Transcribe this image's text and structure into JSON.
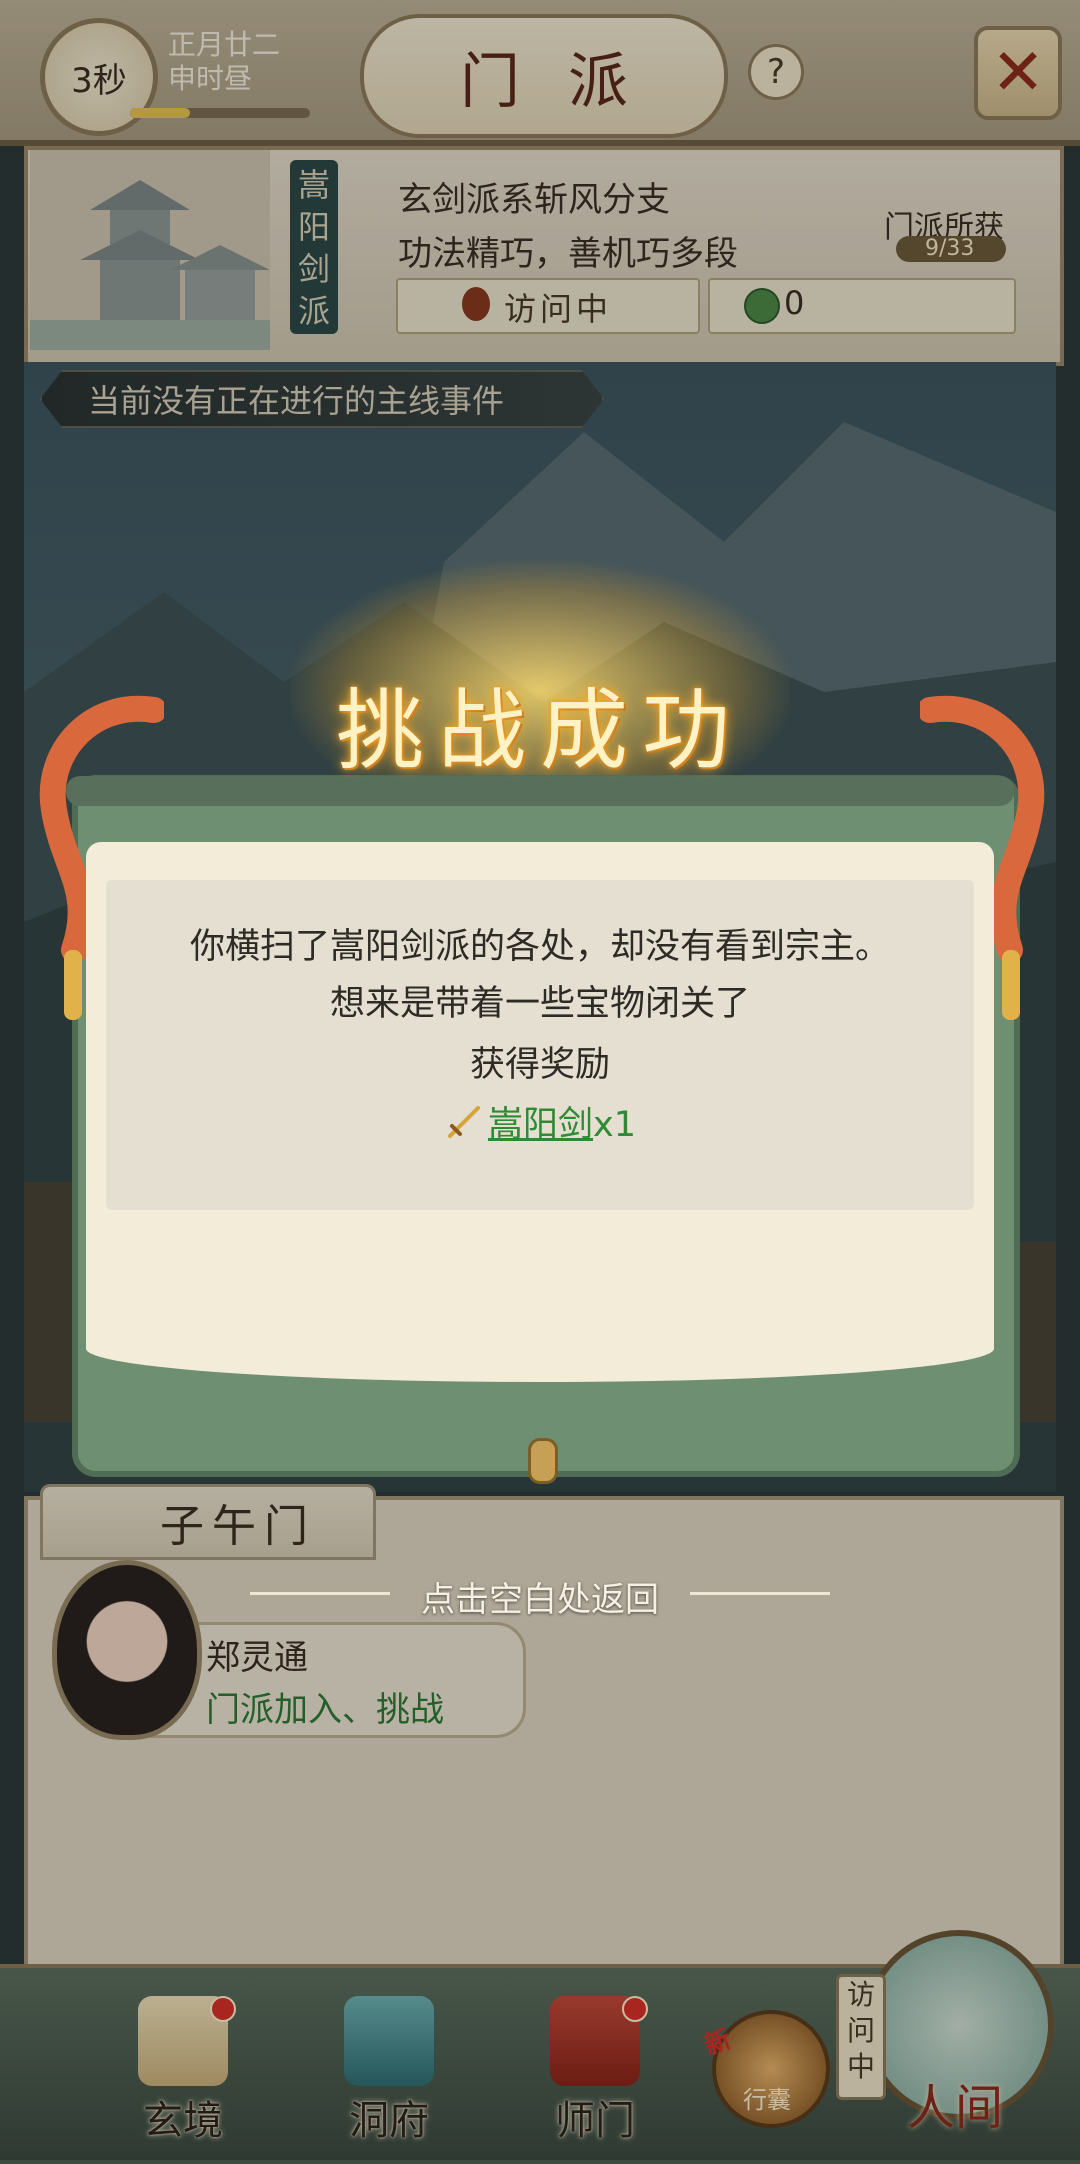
{
  "header": {
    "timer": "3秒",
    "lunar_date": "正月廿二",
    "lunar_time": "申时昼",
    "title": "门派",
    "help_label": "?",
    "close_label": "✕"
  },
  "sect": {
    "banner_name": "嵩阳剑派",
    "description_line1": "玄剑派系斩风分支",
    "description_line2": "功法精巧，善机巧多段",
    "visit_status": "访问中",
    "resource_count": "0",
    "gains_title": "门派所获",
    "gains_count": "9/33"
  },
  "event_banner": "当前没有正在进行的主线事件",
  "dialog": {
    "title": "挑战成功",
    "line1": "你横扫了嵩阳剑派的各处，却没有看到宗主。",
    "line2": "想来是带着一些宝物闭关了",
    "reward_heading": "获得奖励",
    "reward_item": "嵩阳剑",
    "reward_qty": "x1",
    "return_hint": "点击空白处返回"
  },
  "panel": {
    "tab_label": "子午门",
    "npc_name": "郑灵通",
    "npc_actions": "门派加入、挑战"
  },
  "nav": {
    "items": [
      {
        "label": "玄境",
        "icon": "scroll-icon",
        "badge": true
      },
      {
        "label": "洞府",
        "icon": "pavilion-icon",
        "badge": false
      },
      {
        "label": "师门",
        "icon": "banner-icon",
        "badge": true
      }
    ],
    "bag_label": "行囊",
    "bag_tag": "新",
    "world_flag": "访问中",
    "world_label": "人间"
  },
  "colors": {
    "accent_title": "#5a2a1a",
    "reward_green": "#2f8a35",
    "badge_red": "#d8302a"
  }
}
